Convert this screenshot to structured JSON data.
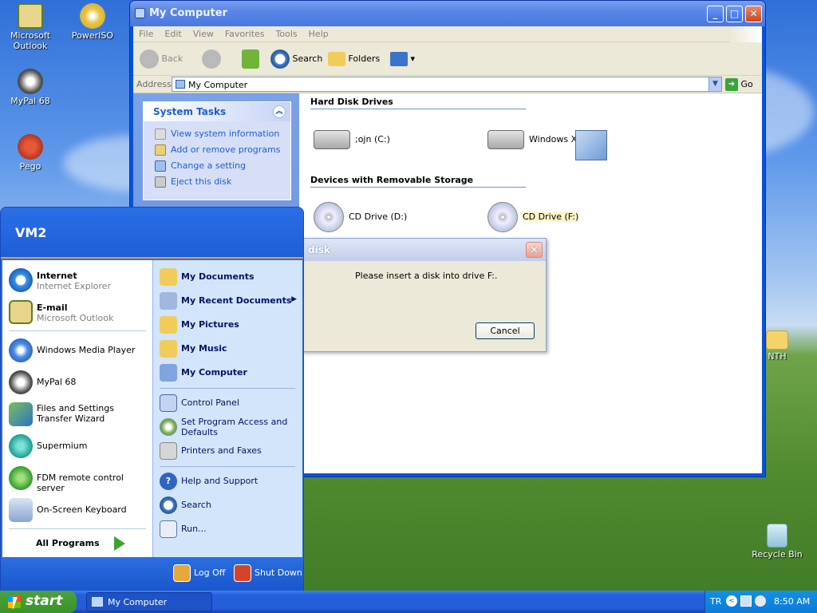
{
  "desktop": {
    "icons": [
      {
        "label": "Microsoft Outlook"
      },
      {
        "label": "PowerISO"
      },
      {
        "label": "MyPal 68"
      },
      {
        "label": "Pego"
      },
      {
        "label": "NTH"
      },
      {
        "label": "Recycle Bin"
      }
    ]
  },
  "explorer": {
    "title": "My Computer",
    "menu": [
      "File",
      "Edit",
      "View",
      "Favorites",
      "Tools",
      "Help"
    ],
    "toolbar": {
      "back": "Back",
      "search": "Search",
      "folders": "Folders"
    },
    "address": {
      "label": "Address",
      "value": "My Computer",
      "go": "Go"
    },
    "system_tasks": {
      "title": "System Tasks",
      "items": [
        "View system information",
        "Add or remove programs",
        "Change a setting",
        "Eject this disk"
      ]
    },
    "sections": [
      {
        "title": "Hard Disk Drives",
        "drives": [
          ";ojn (C:)",
          "Windows XP (E:)"
        ]
      },
      {
        "title": "Devices with Removable Storage",
        "drives": [
          "CD Drive (D:)",
          "CD Drive (F:)"
        ]
      }
    ]
  },
  "dialog": {
    "title": "disk",
    "message": "Please insert a disk into drive F:.",
    "cancel": "Cancel"
  },
  "start_menu": {
    "user": "VM2",
    "pinned": [
      {
        "title": "Internet",
        "subtitle": "Internet Explorer"
      },
      {
        "title": "E-mail",
        "subtitle": "Microsoft Outlook"
      }
    ],
    "recent": [
      "Windows Media Player",
      "MyPal 68",
      "Files and Settings Transfer Wizard",
      "Supermium",
      "FDM remote control server",
      "On-Screen Keyboard"
    ],
    "all_programs": "All Programs",
    "right": {
      "group1": [
        "My Documents",
        "My Recent Documents",
        "My Pictures",
        "My Music",
        "My Computer"
      ],
      "group2": [
        "Control Panel",
        "Set Program Access and Defaults",
        "Printers and Faxes"
      ],
      "group3": [
        "Help and Support",
        "Search",
        "Run..."
      ]
    },
    "footer": {
      "logoff": "Log Off",
      "shutdown": "Shut Down"
    }
  },
  "taskbar": {
    "start": "start",
    "task": "My Computer",
    "language": "TR",
    "clock": "8:50 AM"
  },
  "colors": {
    "xp_blue": "#245edb",
    "start_green": "#39932a",
    "link_blue": "#215dc6"
  }
}
